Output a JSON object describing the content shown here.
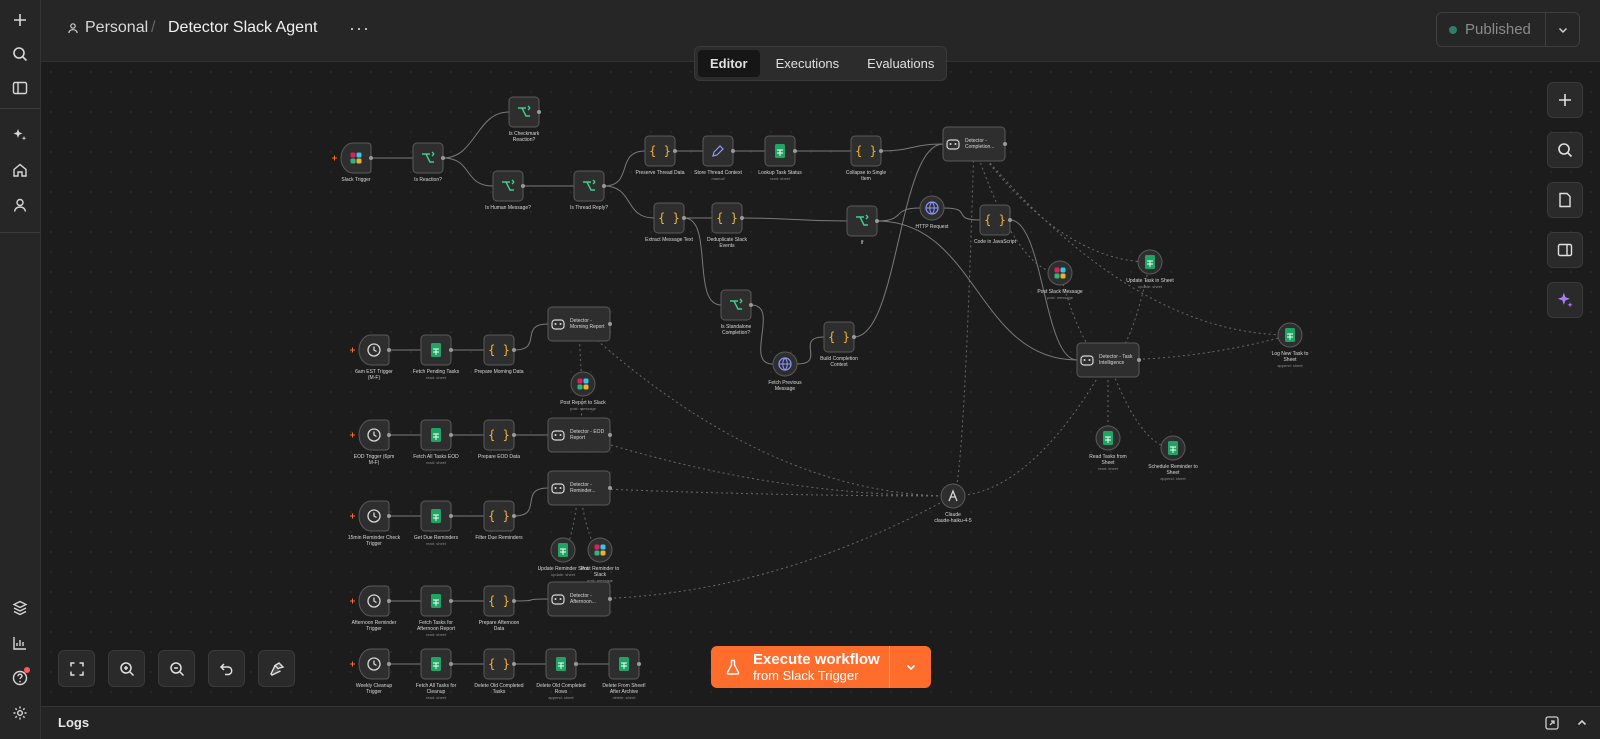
{
  "header": {
    "project": "Personal",
    "workflow_name": "Detector Slack Agent",
    "published_label": "Published"
  },
  "tabs": [
    "Editor",
    "Executions",
    "Evaluations"
  ],
  "execute": {
    "label": "Execute workflow",
    "sublabel": "from Slack Trigger"
  },
  "logs_label": "Logs",
  "colors": {
    "accent": "#ff6d2d",
    "background": "#1c1c1c",
    "published_dot": "#2e7d6a"
  },
  "nodes": [
    {
      "id": "n1",
      "label": "Slack Trigger",
      "icon": "slack-icon"
    },
    {
      "id": "n2",
      "label": "Is Reaction?",
      "icon": "switch-icon"
    },
    {
      "id": "n3",
      "label": "Is Checkmark Reaction?",
      "icon": "switch-icon"
    },
    {
      "id": "n4",
      "label": "Is Human Message?",
      "icon": "switch-icon"
    },
    {
      "id": "n5",
      "label": "Is Thread Reply?",
      "icon": "switch-icon"
    },
    {
      "id": "n6",
      "label": "Preserve Thread Data",
      "icon": "code-icon"
    },
    {
      "id": "n7",
      "label": "Store Thread Context",
      "sub": "manual",
      "icon": "edit-icon"
    },
    {
      "id": "n8",
      "label": "Lookup Task Status",
      "sub": "read: sheet",
      "icon": "sheets-icon"
    },
    {
      "id": "n9",
      "label": "Collapse to Single Item",
      "icon": "code-icon"
    },
    {
      "id": "n10",
      "label": "Detector - Completion...",
      "icon": "agent-icon"
    },
    {
      "id": "n11",
      "label": "Extract Message Text",
      "icon": "code-icon"
    },
    {
      "id": "n12",
      "label": "Deduplicate Slack Events",
      "icon": "code-icon"
    },
    {
      "id": "n13",
      "label": "If",
      "icon": "switch-icon"
    },
    {
      "id": "n14",
      "label": "HTTP Request",
      "icon": "globe-icon"
    },
    {
      "id": "n15",
      "label": "Code in JavaScript",
      "icon": "code-icon"
    },
    {
      "id": "n16",
      "label": "Post Slack Message",
      "sub": "post: message",
      "icon": "slack-icon"
    },
    {
      "id": "n17",
      "label": "Update Task in Sheet",
      "sub": "update: sheet",
      "icon": "sheets-icon"
    },
    {
      "id": "n18",
      "label": "Log New Task to Sheet",
      "sub": "append: sheet",
      "icon": "sheets-icon"
    },
    {
      "id": "n19",
      "label": "Is Standalone Completion?",
      "icon": "switch-icon"
    },
    {
      "id": "n20",
      "label": "Fetch Previous Message",
      "icon": "globe-icon"
    },
    {
      "id": "n21",
      "label": "Build Completion Context",
      "icon": "code-icon"
    },
    {
      "id": "n22",
      "label": "Detector - Task Intelligence",
      "icon": "agent-icon"
    },
    {
      "id": "n23",
      "label": "Read Tasks from Sheet",
      "sub": "read: sheet",
      "icon": "sheets-icon"
    },
    {
      "id": "n24",
      "label": "Schedule Reminder to Sheet",
      "sub": "append: sheet",
      "icon": "sheets-icon"
    },
    {
      "id": "n25",
      "label": "6am EST Trigger (M-F)",
      "icon": "clock-icon"
    },
    {
      "id": "n26",
      "label": "Fetch Pending Tasks",
      "sub": "read: sheet",
      "icon": "sheets-icon"
    },
    {
      "id": "n27",
      "label": "Prepare Morning Data",
      "icon": "code-icon"
    },
    {
      "id": "n28",
      "label": "Detector - Morning Report",
      "icon": "agent-icon"
    },
    {
      "id": "n29",
      "label": "Post Report to Slack",
      "sub": "post: message",
      "icon": "slack-icon"
    },
    {
      "id": "n30",
      "label": "EOD Trigger (6pm M-F)",
      "icon": "clock-icon"
    },
    {
      "id": "n31",
      "label": "Fetch All Tasks EOD",
      "sub": "read: sheet",
      "icon": "sheets-icon"
    },
    {
      "id": "n32",
      "label": "Prepare EOD Data",
      "icon": "code-icon"
    },
    {
      "id": "n33",
      "label": "Detector - EOD Report",
      "icon": "agent-icon"
    },
    {
      "id": "n34",
      "label": "15min Reminder Check Trigger",
      "icon": "clock-icon"
    },
    {
      "id": "n35",
      "label": "Get Due Reminders",
      "sub": "read: sheet",
      "icon": "sheets-icon"
    },
    {
      "id": "n36",
      "label": "Filter Due Reminders",
      "icon": "code-icon"
    },
    {
      "id": "n37",
      "label": "Detector - Reminder...",
      "icon": "agent-icon"
    },
    {
      "id": "n38",
      "label": "Update Reminder Sent",
      "sub": "update: sheet",
      "icon": "sheets-icon"
    },
    {
      "id": "n39",
      "label": "Post Reminder to Slack",
      "sub": "post: message",
      "icon": "slack-icon"
    },
    {
      "id": "n40",
      "label": "Claude claude-haiku-4-5",
      "icon": "anthropic-icon"
    },
    {
      "id": "n41",
      "label": "Afternoon Reminder Trigger",
      "icon": "clock-icon"
    },
    {
      "id": "n42",
      "label": "Fetch Tasks for Afternoon Report",
      "sub": "read: sheet",
      "icon": "sheets-icon"
    },
    {
      "id": "n43",
      "label": "Prepare Afternoon Data",
      "icon": "code-icon"
    },
    {
      "id": "n44",
      "label": "Detector - Afternoon...",
      "icon": "agent-icon"
    },
    {
      "id": "n45",
      "label": "Weekly Cleanup Trigger",
      "icon": "clock-icon"
    },
    {
      "id": "n46",
      "label": "Fetch All Tasks for Cleanup",
      "sub": "read: sheet",
      "icon": "sheets-icon"
    },
    {
      "id": "n47",
      "label": "Delete Old Completed Tasks",
      "icon": "code-icon"
    },
    {
      "id": "n48",
      "label": "Delete Old Completed Rows",
      "sub": "append: sheet",
      "icon": "sheets-icon"
    },
    {
      "id": "n49",
      "label": "Delete From Sheet! After Archive",
      "sub": "delete: sheet",
      "icon": "sheets-icon"
    }
  ]
}
